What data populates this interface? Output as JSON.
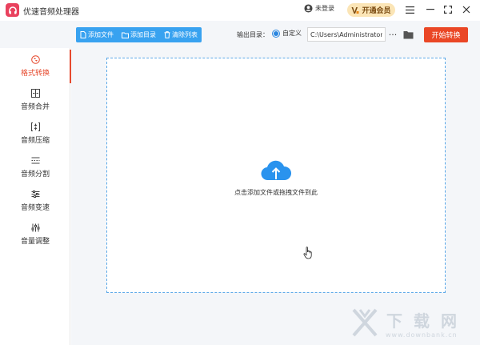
{
  "app": {
    "title": "优速音频处理器",
    "login_label": "未登录",
    "vip_label": "开通会员"
  },
  "toolbar": {
    "add_file": "添加文件",
    "add_dir": "添加目录",
    "clear_list": "清除列表",
    "output_label": "输出目录：",
    "custom_label": "自定义",
    "path_value": "C:\\Users\\Administrator\\",
    "more_label": "···",
    "start_label": "开始转换"
  },
  "sidebar": {
    "items": [
      {
        "label": "格式转换",
        "icon": "format-convert-icon",
        "active": true
      },
      {
        "label": "音频合并",
        "icon": "audio-merge-icon"
      },
      {
        "label": "音频压缩",
        "icon": "audio-compress-icon"
      },
      {
        "label": "音频分割",
        "icon": "audio-split-icon"
      },
      {
        "label": "音频变速",
        "icon": "audio-speed-icon"
      },
      {
        "label": "音量调整",
        "icon": "volume-adjust-icon"
      }
    ]
  },
  "dropzone": {
    "text": "点击添加文件或拖拽文件到此",
    "icon": "cloud-upload-icon"
  },
  "watermark": {
    "cn": "下载网",
    "url": "www.downbank.cn"
  },
  "colors": {
    "accent": "#e64a2e",
    "blue": "#38a2f0",
    "start": "#ea4726",
    "brand": "#e9425e"
  }
}
